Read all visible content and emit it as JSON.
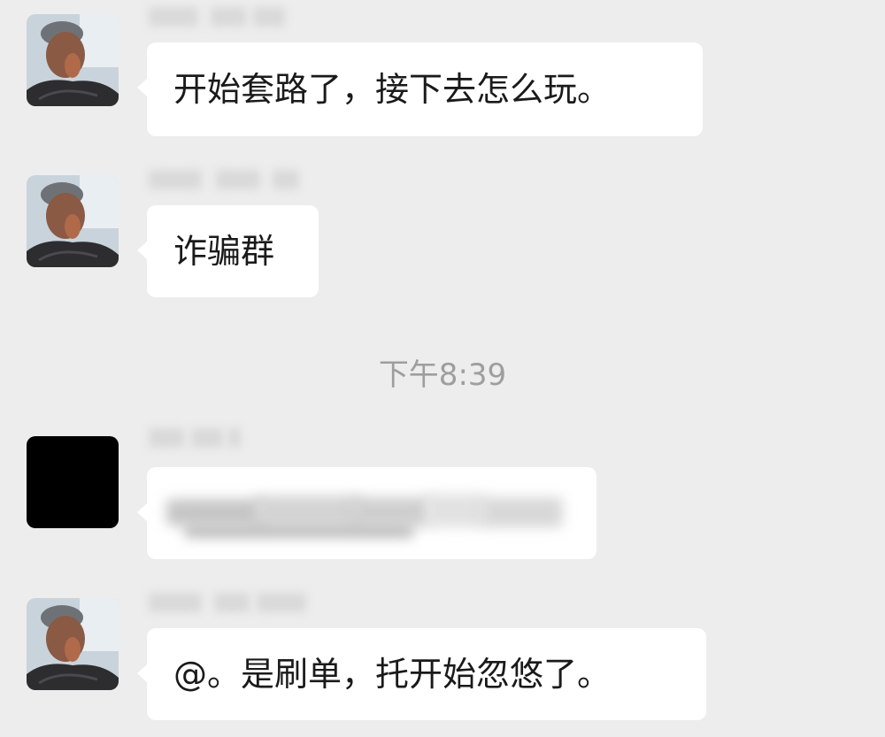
{
  "timestamp": "下午8:39",
  "messages": [
    {
      "text": "开始套路了，接下去怎么玩。",
      "avatar": "photo-avatar-icon"
    },
    {
      "text": "诈骗群",
      "avatar": "photo-avatar-icon"
    },
    {
      "text": "",
      "avatar": "black-avatar"
    },
    {
      "text": "@。是刷单，托开始忽悠了。",
      "avatar": "photo-avatar-icon"
    }
  ],
  "colors": {
    "background": "#ededed",
    "bubble": "#ffffff",
    "text": "#1a1a1a",
    "timestamp": "#9e9e9e"
  }
}
